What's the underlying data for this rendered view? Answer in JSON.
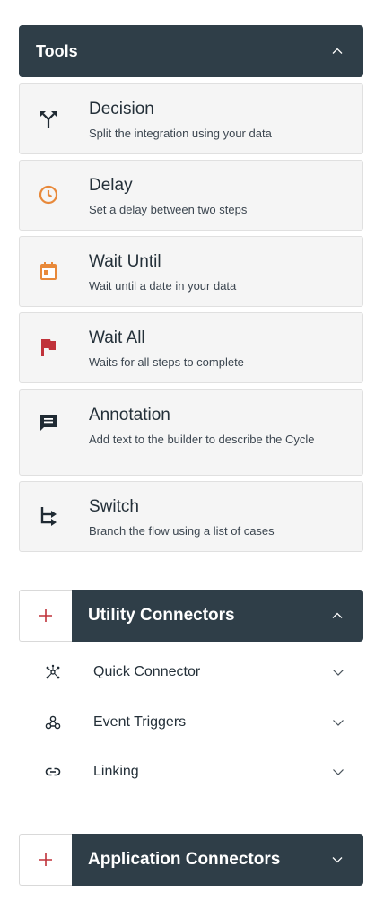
{
  "tools": {
    "title": "Tools",
    "items": [
      {
        "name": "Decision",
        "desc": "Split the integration using your data",
        "icon": "split-arrows-icon"
      },
      {
        "name": "Delay",
        "desc": "Set a delay between two steps",
        "icon": "clock-icon"
      },
      {
        "name": "Wait Until",
        "desc": "Wait until a date in your data",
        "icon": "calendar-icon"
      },
      {
        "name": "Wait All",
        "desc": "Waits for all steps to complete",
        "icon": "flag-icon"
      },
      {
        "name": "Annotation",
        "desc": "Add text to the builder to describe the Cycle",
        "icon": "comment-icon"
      },
      {
        "name": "Switch",
        "desc": "Branch the flow using a list of cases",
        "icon": "branch-arrow-icon"
      }
    ]
  },
  "utility_connectors": {
    "title": "Utility Connectors",
    "items": [
      {
        "label": "Quick Connector",
        "icon": "hub-icon"
      },
      {
        "label": "Event Triggers",
        "icon": "webhook-icon"
      },
      {
        "label": "Linking",
        "icon": "link-icon"
      }
    ]
  },
  "application_connectors": {
    "title": "Application Connectors"
  },
  "colors": {
    "header_bg": "#2f3e48",
    "plus": "#c0323a",
    "clock": "#e8893a",
    "calendar": "#e8893a",
    "flag": "#c0323a"
  }
}
